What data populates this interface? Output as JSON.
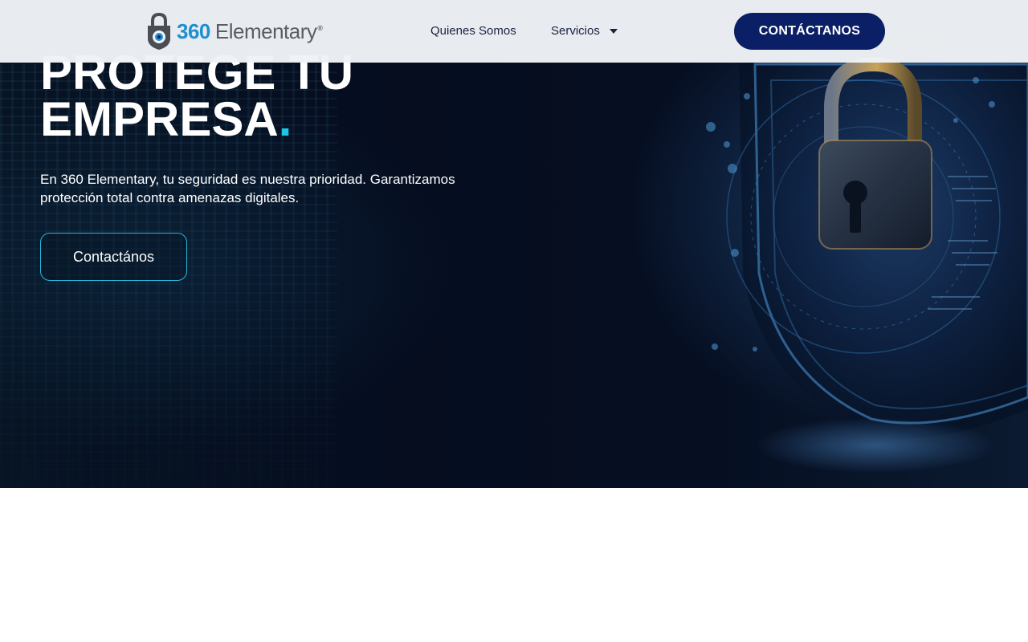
{
  "navbar": {
    "logo": {
      "number": "360",
      "word": "Elementary",
      "registered": "®"
    },
    "links": [
      {
        "label": "Quienes Somos"
      },
      {
        "label": "Servicios"
      }
    ],
    "cta_label": "CONTÁCTANOS"
  },
  "hero": {
    "headline_line1": "PROTEGE TU",
    "headline_line2": "EMPRESA",
    "headline_dot": ".",
    "subtext": "En 360 Elementary, tu seguridad es nuestra prioridad. Garantizamos protección total contra amenazas digitales.",
    "cta_label": "Contactános"
  },
  "colors": {
    "brand_navy": "#0b1f66",
    "brand_blue": "#1e8fd0",
    "accent_cyan": "#19c6e6",
    "hero_bg": "#050d1f"
  },
  "icons": [
    "logo-shield-lock-icon",
    "chevron-down-icon",
    "padlock-shield-illustration"
  ]
}
